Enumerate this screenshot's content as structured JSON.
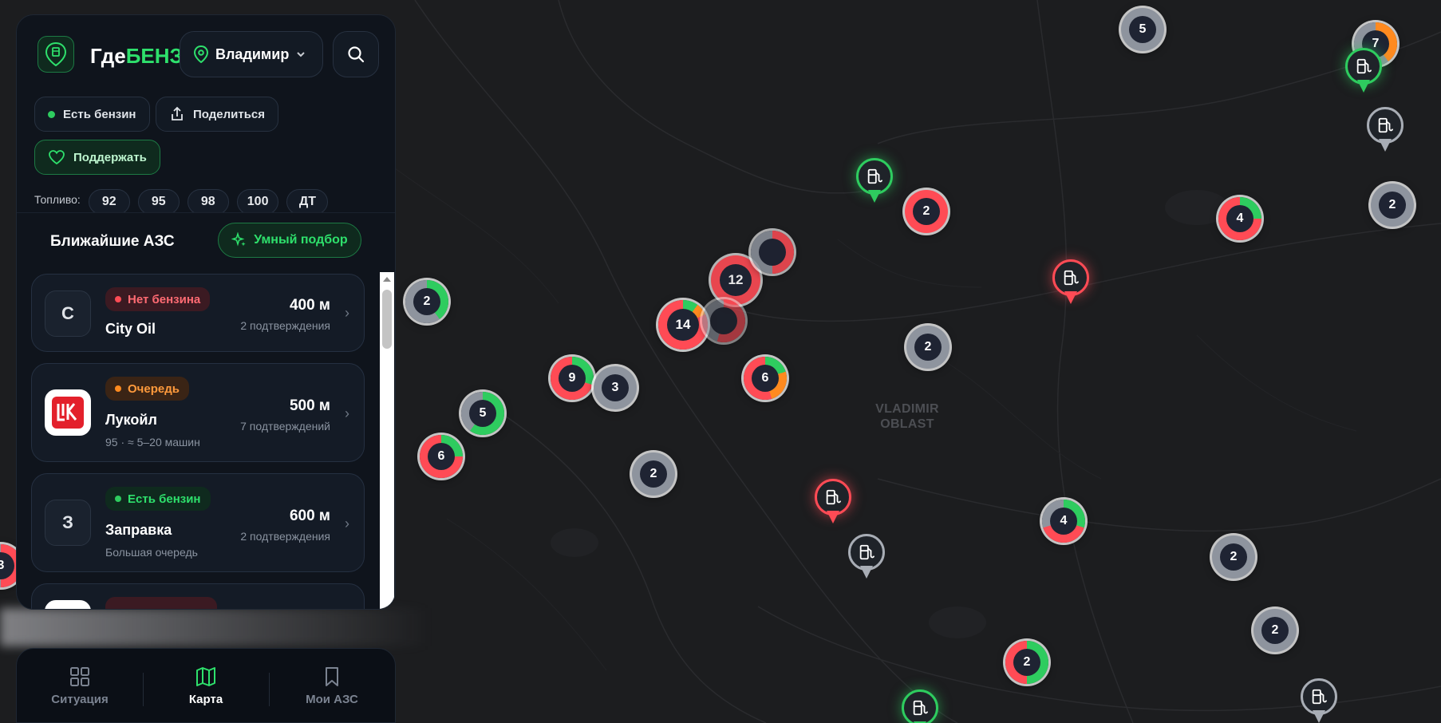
{
  "app": {
    "brand_part1": "Где",
    "brand_part2": "БЕНЗ",
    "city": "Владимир"
  },
  "chips": {
    "has_fuel": "Есть бензин",
    "share": "Поделиться",
    "support": "Поддержать"
  },
  "fuel": {
    "label": "Топливо:",
    "types": [
      "92",
      "95",
      "98",
      "100",
      "ДТ"
    ]
  },
  "nearby": {
    "title": "Ближайшие АЗС",
    "smart_button": "Умный подбор"
  },
  "stations": [
    {
      "logo_letter": "C",
      "status": "Нет бензина",
      "status_color": "red",
      "name": "City Oil",
      "distance": "400 м",
      "confirmations": "2 подтверждения",
      "sub": ""
    },
    {
      "logo_letter": "",
      "logo": "lukoil-logo",
      "status": "Очередь",
      "status_color": "orange",
      "name": "Лукойл",
      "distance": "500 м",
      "confirmations": "7 подтверждений",
      "sub": "95 · ≈ 5–20 машин"
    },
    {
      "logo_letter": "З",
      "status": "Есть бензин",
      "status_color": "green",
      "name": "Заправка",
      "distance": "600 м",
      "confirmations": "2 подтверждения",
      "sub": "Большая очередь"
    }
  ],
  "map": {
    "region_label_line1": "VLADIMIR",
    "region_label_line2": "OBLAST",
    "clusters": [
      "5",
      "7",
      "2",
      "4",
      "2",
      "2",
      "14",
      "12",
      "6",
      "9",
      "3",
      "5",
      "6",
      "2",
      "4",
      "2",
      "2",
      "2",
      "3"
    ]
  },
  "nav": {
    "situation": "Ситуация",
    "map": "Карта",
    "my_stations": "Мои АЗС"
  },
  "colors": {
    "accent": "#2ee06c",
    "red": "#ff4b55",
    "orange": "#ff8a1f",
    "panel": "#0f141c"
  }
}
